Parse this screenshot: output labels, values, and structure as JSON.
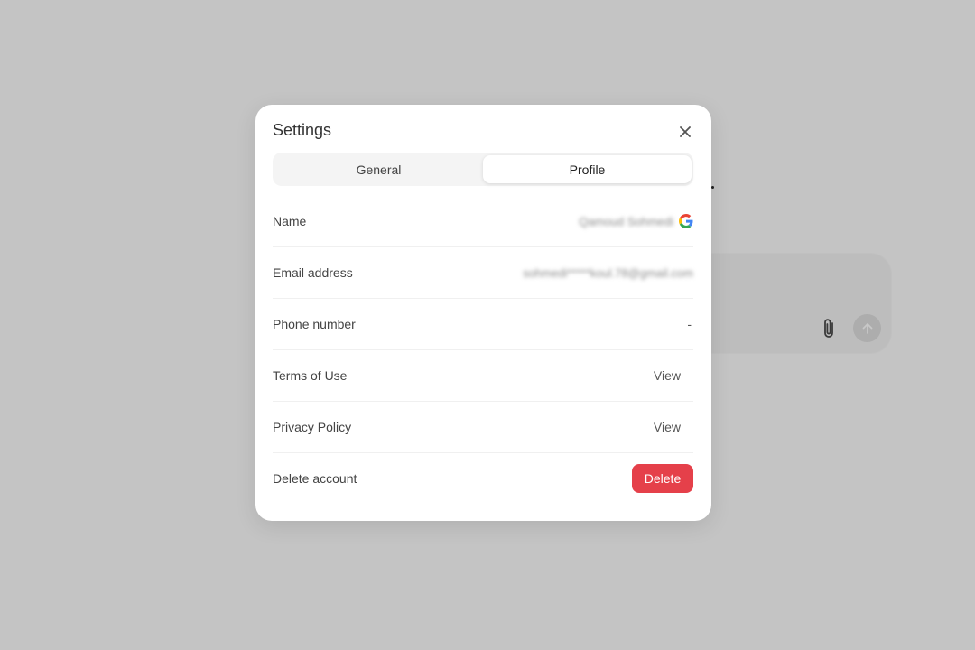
{
  "modal": {
    "title": "Settings",
    "close_icon": "close-icon"
  },
  "tabs": [
    {
      "label": "General",
      "selected": false
    },
    {
      "label": "Profile",
      "selected": true
    }
  ],
  "rows": {
    "name": {
      "label": "Name",
      "value": "Qamoud Sohmedi",
      "provider_icon": "google-icon"
    },
    "email": {
      "label": "Email address",
      "value": "sohmedi*****koul.78@gmail.com"
    },
    "phone": {
      "label": "Phone number",
      "value": "-"
    },
    "terms": {
      "label": "Terms of Use",
      "action": "View"
    },
    "privacy": {
      "label": "Privacy Policy",
      "action": "View"
    },
    "delete": {
      "label": "Delete account",
      "action": "Delete"
    }
  },
  "colors": {
    "danger": "#e5404a",
    "backdrop": "#c4c4c4"
  },
  "background_composer": {
    "icons": [
      "paperclip-icon",
      "arrow-up-icon"
    ]
  }
}
